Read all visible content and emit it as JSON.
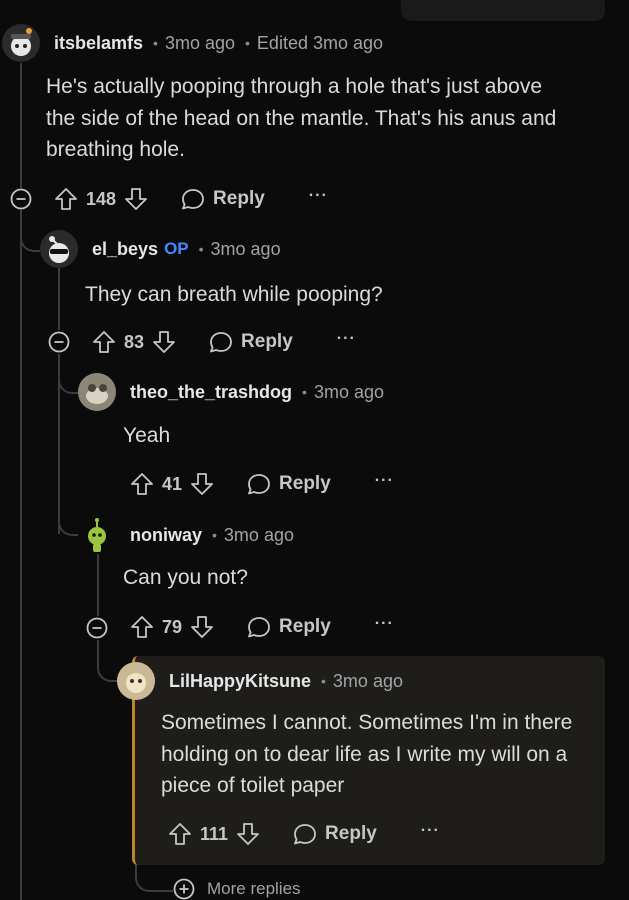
{
  "comments": [
    {
      "username": "itsbelamfs",
      "time": "3mo ago",
      "edited": "Edited 3mo ago",
      "body": [
        "He's actually pooping through a hole that's just above",
        "the side of the head on the mantle. That's his anus and",
        "breathing hole."
      ],
      "votes": "148",
      "reply_label": "Reply"
    },
    {
      "username": "el_beys",
      "badge": "OP",
      "time": "3mo ago",
      "body": [
        "They can breath while pooping?"
      ],
      "votes": "83",
      "reply_label": "Reply"
    },
    {
      "username": "theo_the_trashdog",
      "time": "3mo ago",
      "body": [
        "Yeah"
      ],
      "votes": "41",
      "reply_label": "Reply"
    },
    {
      "username": "noniway",
      "time": "3mo ago",
      "body": [
        "Can you not?"
      ],
      "votes": "79",
      "reply_label": "Reply"
    },
    {
      "username": "LilHappyKitsune",
      "time": "3mo ago",
      "body": [
        "Sometimes I cannot. Sometimes I'm in there",
        "holding on to dear life as I write my will on a",
        "piece of toilet paper"
      ],
      "votes": "111",
      "reply_label": "Reply"
    }
  ],
  "more_replies_label": "More replies",
  "icons": {
    "upvote": "upvote-arrow-icon",
    "downvote": "downvote-arrow-icon",
    "reply": "speech-bubble-icon",
    "more": "ellipsis-icon",
    "collapse": "minus-circle-icon",
    "expand": "plus-circle-icon"
  },
  "colors": {
    "background": "#0b0b0c",
    "op_badge": "#3f88ff",
    "highlight_bar": "#b9852e",
    "highlight_bg": "#1f1d1a"
  }
}
